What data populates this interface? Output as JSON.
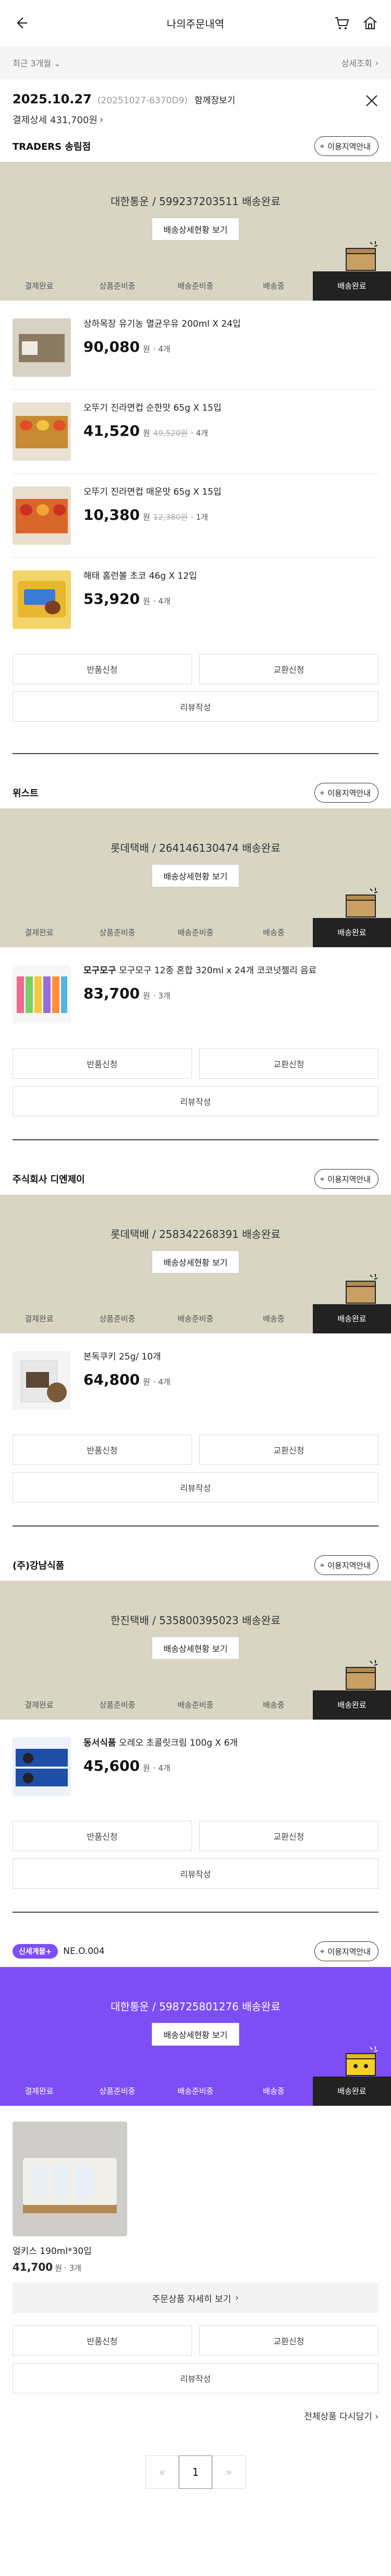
{
  "header": {
    "title": "나의주문내역"
  },
  "filter": {
    "period": "최근 3개월",
    "detail": "상세조회"
  },
  "order": {
    "date": "2025.10.27",
    "number": "(20251027-6370D9)",
    "combined": "함께장보기",
    "payment": "결제상세 431,700원"
  },
  "common": {
    "inquiry": "이용지역안내",
    "tracking_button": "배송상세현황 보기",
    "steps": [
      "결제완료",
      "상품준비중",
      "배송준비중",
      "배송중",
      "배송완료"
    ],
    "return": "반품신청",
    "exchange": "교환신청",
    "review": "리뷰작성",
    "won": "원",
    "sep": "·"
  },
  "sellers": [
    {
      "name": "TRADERS 송림점",
      "carrier": "대한통운 / 599237203511 배송완료",
      "products": [
        {
          "name": "상하목장 유기농 멸균우유 200ml X 24입",
          "price": "90,080",
          "orig": "",
          "qty": "4개"
        },
        {
          "name": "오뚜기 진라면컵 순한맛 65g X 15입",
          "price": "41,520",
          "orig": "49,520원",
          "qty": "4개"
        },
        {
          "name": "오뚜기 진라면컵 매운맛 65g X 15입",
          "price": "10,380",
          "orig": "12,380원",
          "qty": "1개"
        },
        {
          "name": "해태 홈런볼 초코 46g X 12입",
          "price": "53,920",
          "orig": "",
          "qty": "4개"
        }
      ]
    },
    {
      "name": "위스트",
      "carrier": "롯데택배 / 264146130474 배송완료",
      "products": [
        {
          "brand": "모구모구",
          "name": "모구모구 12종 혼합 320ml x 24개 코코넛젤리 음료",
          "price": "83,700",
          "orig": "",
          "qty": "3개"
        }
      ]
    },
    {
      "name": "주식회사 디엔제이",
      "carrier": "롯데택배 / 258342268391 배송완료",
      "products": [
        {
          "name": "본독쿠키 25g/ 10개",
          "price": "64,800",
          "orig": "",
          "qty": "4개"
        }
      ]
    },
    {
      "name": "(주)강남식품",
      "carrier": "한진택배 / 535800395023 배송완료",
      "products": [
        {
          "brand": "동서식품",
          "name": "오레오 초콜릿크림 100g X 6개",
          "price": "45,600",
          "orig": "",
          "qty": "4개"
        }
      ]
    },
    {
      "badge": "신세계몰+",
      "name": "NE.O.004",
      "carrier": "대한통운 / 598725801276 배송완료",
      "products": [
        {
          "name": "얼키스 190ml*30입",
          "price": "41,700",
          "qty": "3개"
        }
      ],
      "more": "주문상품 자세히 보기",
      "allagain": "전체상품 다시담기"
    }
  ],
  "pager": {
    "current": "1",
    "prev": "«",
    "next": "»"
  },
  "colors": {
    "beige": "#d9d5c3",
    "purple": "#7d4ef5",
    "dark": "#222222"
  }
}
